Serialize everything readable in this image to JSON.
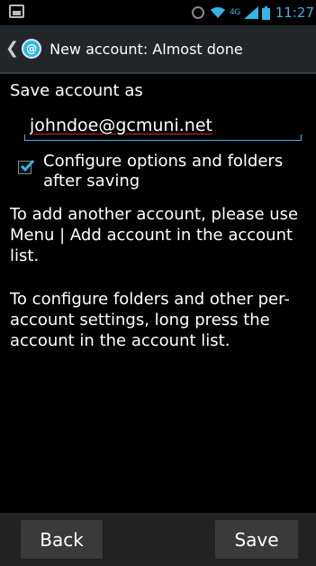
{
  "status_bar": {
    "network_type": "4G",
    "time": "11:27"
  },
  "action_bar": {
    "title": "New account: Almost done"
  },
  "form": {
    "save_as_label": "Save account as",
    "email_value": "johndoe@gcmuni.net",
    "configure_checkbox_label": "Configure options and folders after saving",
    "configure_checked": true,
    "info_add_account": "To add another account, please use Menu | Add account in the account list.",
    "info_configure_folders": "To configure folders and other per-account settings, long press the account in the account list."
  },
  "buttons": {
    "back_label": "Back",
    "save_label": "Save"
  },
  "colors": {
    "accent": "#33b5e5",
    "background": "#000000",
    "action_bar": "#222629",
    "button": "#3a3a3a"
  }
}
